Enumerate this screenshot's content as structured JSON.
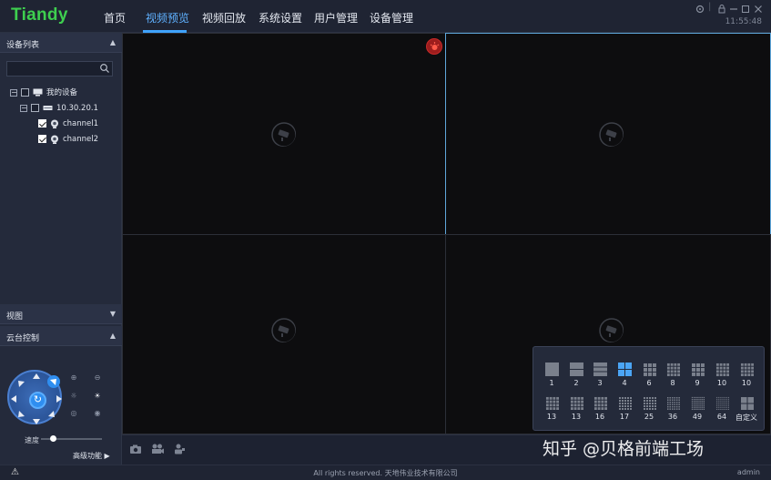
{
  "app": {
    "logo": "Tiandy",
    "clock": "11:55:48"
  },
  "nav": {
    "items": [
      {
        "label": "首页"
      },
      {
        "label": "视频预览"
      },
      {
        "label": "视频回放"
      },
      {
        "label": "系统设置"
      },
      {
        "label": "用户管理"
      },
      {
        "label": "设备管理"
      }
    ],
    "active_index": 1
  },
  "window_controls": [
    "settings-icon",
    "lock-icon",
    "minimize-icon",
    "maximize-icon",
    "close-icon"
  ],
  "sidebar": {
    "device_list_title": "设备列表",
    "search_placeholder": "",
    "tree": [
      {
        "label": "我的设备",
        "expanded": true,
        "checked": false
      },
      {
        "label": "10.30.20.1",
        "expanded": true,
        "checked": false
      },
      {
        "label": "channel1",
        "checked": true
      },
      {
        "label": "channel2",
        "checked": true
      }
    ],
    "view_title": "视图",
    "ptz_title": "云台控制",
    "speed_label": "速度",
    "speed_value": 0.2,
    "advanced_label": "高级功能 ▶"
  },
  "layouts": [
    {
      "label": "1"
    },
    {
      "label": "2"
    },
    {
      "label": "3"
    },
    {
      "label": "4",
      "selected": true
    },
    {
      "label": "6"
    },
    {
      "label": "8"
    },
    {
      "label": "9"
    },
    {
      "label": "10"
    },
    {
      "label": "10"
    },
    {
      "label": "13"
    },
    {
      "label": "13"
    },
    {
      "label": "16"
    },
    {
      "label": "17"
    },
    {
      "label": "25"
    },
    {
      "label": "36"
    },
    {
      "label": "49"
    },
    {
      "label": "64"
    },
    {
      "label": "自定义"
    }
  ],
  "statusbar": {
    "copyright": "All rights reserved. 天地伟业技术有限公司",
    "user": "admin"
  },
  "watermark": "知乎 @贝格前端工场",
  "colors": {
    "accent": "#3fa3ff",
    "logo": "#3ecf4f",
    "alarm": "#9d1d1d"
  }
}
